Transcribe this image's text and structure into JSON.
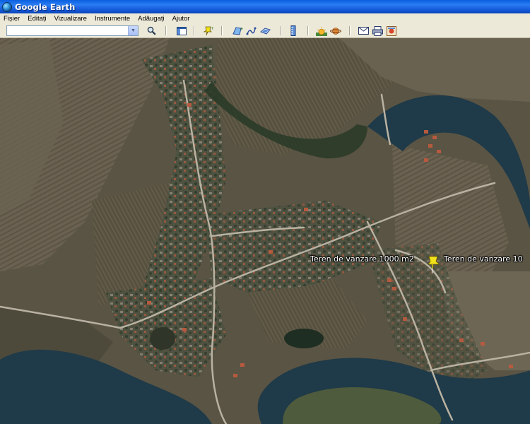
{
  "window": {
    "title": "Google Earth"
  },
  "menu": [
    "Fișier",
    "Editați",
    "Vizualizare",
    "Instrumente",
    "Adăugați",
    "Ajutor"
  ],
  "search": {
    "value": ""
  },
  "toolbar_icons": [
    "search-icon",
    "sidebar-icon",
    "placemark-icon",
    "polygon-icon",
    "path-icon",
    "overlay-icon",
    "ruler-icon",
    "sun-icon",
    "planets-icon",
    "email-icon",
    "print-icon",
    "google-maps-icon"
  ],
  "placemarks": [
    {
      "label": "Teren de vanzare 1000 m2"
    },
    {
      "label": "Teren de vanzare 10"
    }
  ],
  "colors": {
    "titlebar": "#1458d8",
    "chrome": "#ece9d8",
    "pin": "#f2e21a",
    "water": "#1f3a48"
  }
}
